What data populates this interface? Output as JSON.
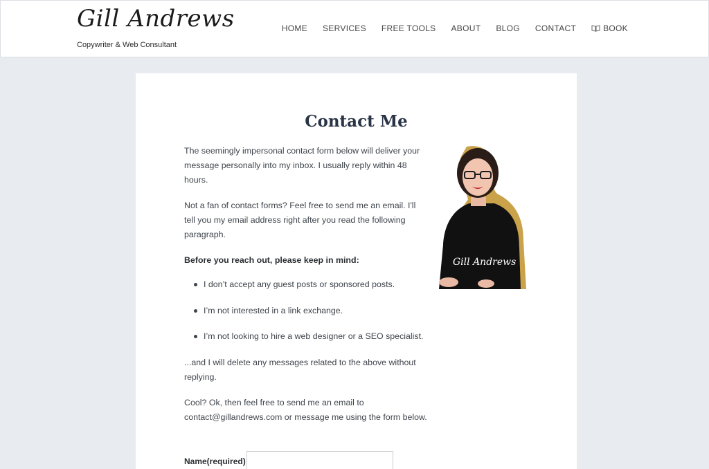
{
  "header": {
    "logo_text": "Gill Andrews",
    "tagline": "Copywriter & Web Consultant",
    "nav": [
      {
        "label": "HOME"
      },
      {
        "label": "SERVICES"
      },
      {
        "label": "FREE TOOLS"
      },
      {
        "label": "ABOUT"
      },
      {
        "label": "BLOG"
      },
      {
        "label": "CONTACT"
      },
      {
        "label": "BOOK",
        "icon": "book-icon"
      }
    ]
  },
  "main": {
    "title": "Contact Me",
    "paragraph_1": "The seemingly impersonal contact form below will deliver your message personally into my inbox. I usually reply within 48 hours.",
    "paragraph_2": "Not a fan of contact forms? Feel free to send me an email. I'll tell you my email address right after you read the following paragraph.",
    "keep_in_mind": "Before you reach out, please keep in mind:",
    "bullets": [
      "I don’t accept any guest posts or sponsored posts.",
      "I’m not interested in a link exchange.",
      "I’m not looking to hire a web designer or a SEO specialist."
    ],
    "paragraph_3": "...and I will delete any messages related to the above without replying.",
    "paragraph_4": "Cool? Ok, then feel free to send me an email to contact@gillandrews.com or message me using the form below.",
    "portrait_signature": "Gill Andrews"
  },
  "form": {
    "name_label": "Name(required)",
    "name_value": ""
  },
  "colors": {
    "page_background": "#e8ebf0",
    "title_color": "#2a3447",
    "accent_gold": "#c9a24a"
  }
}
